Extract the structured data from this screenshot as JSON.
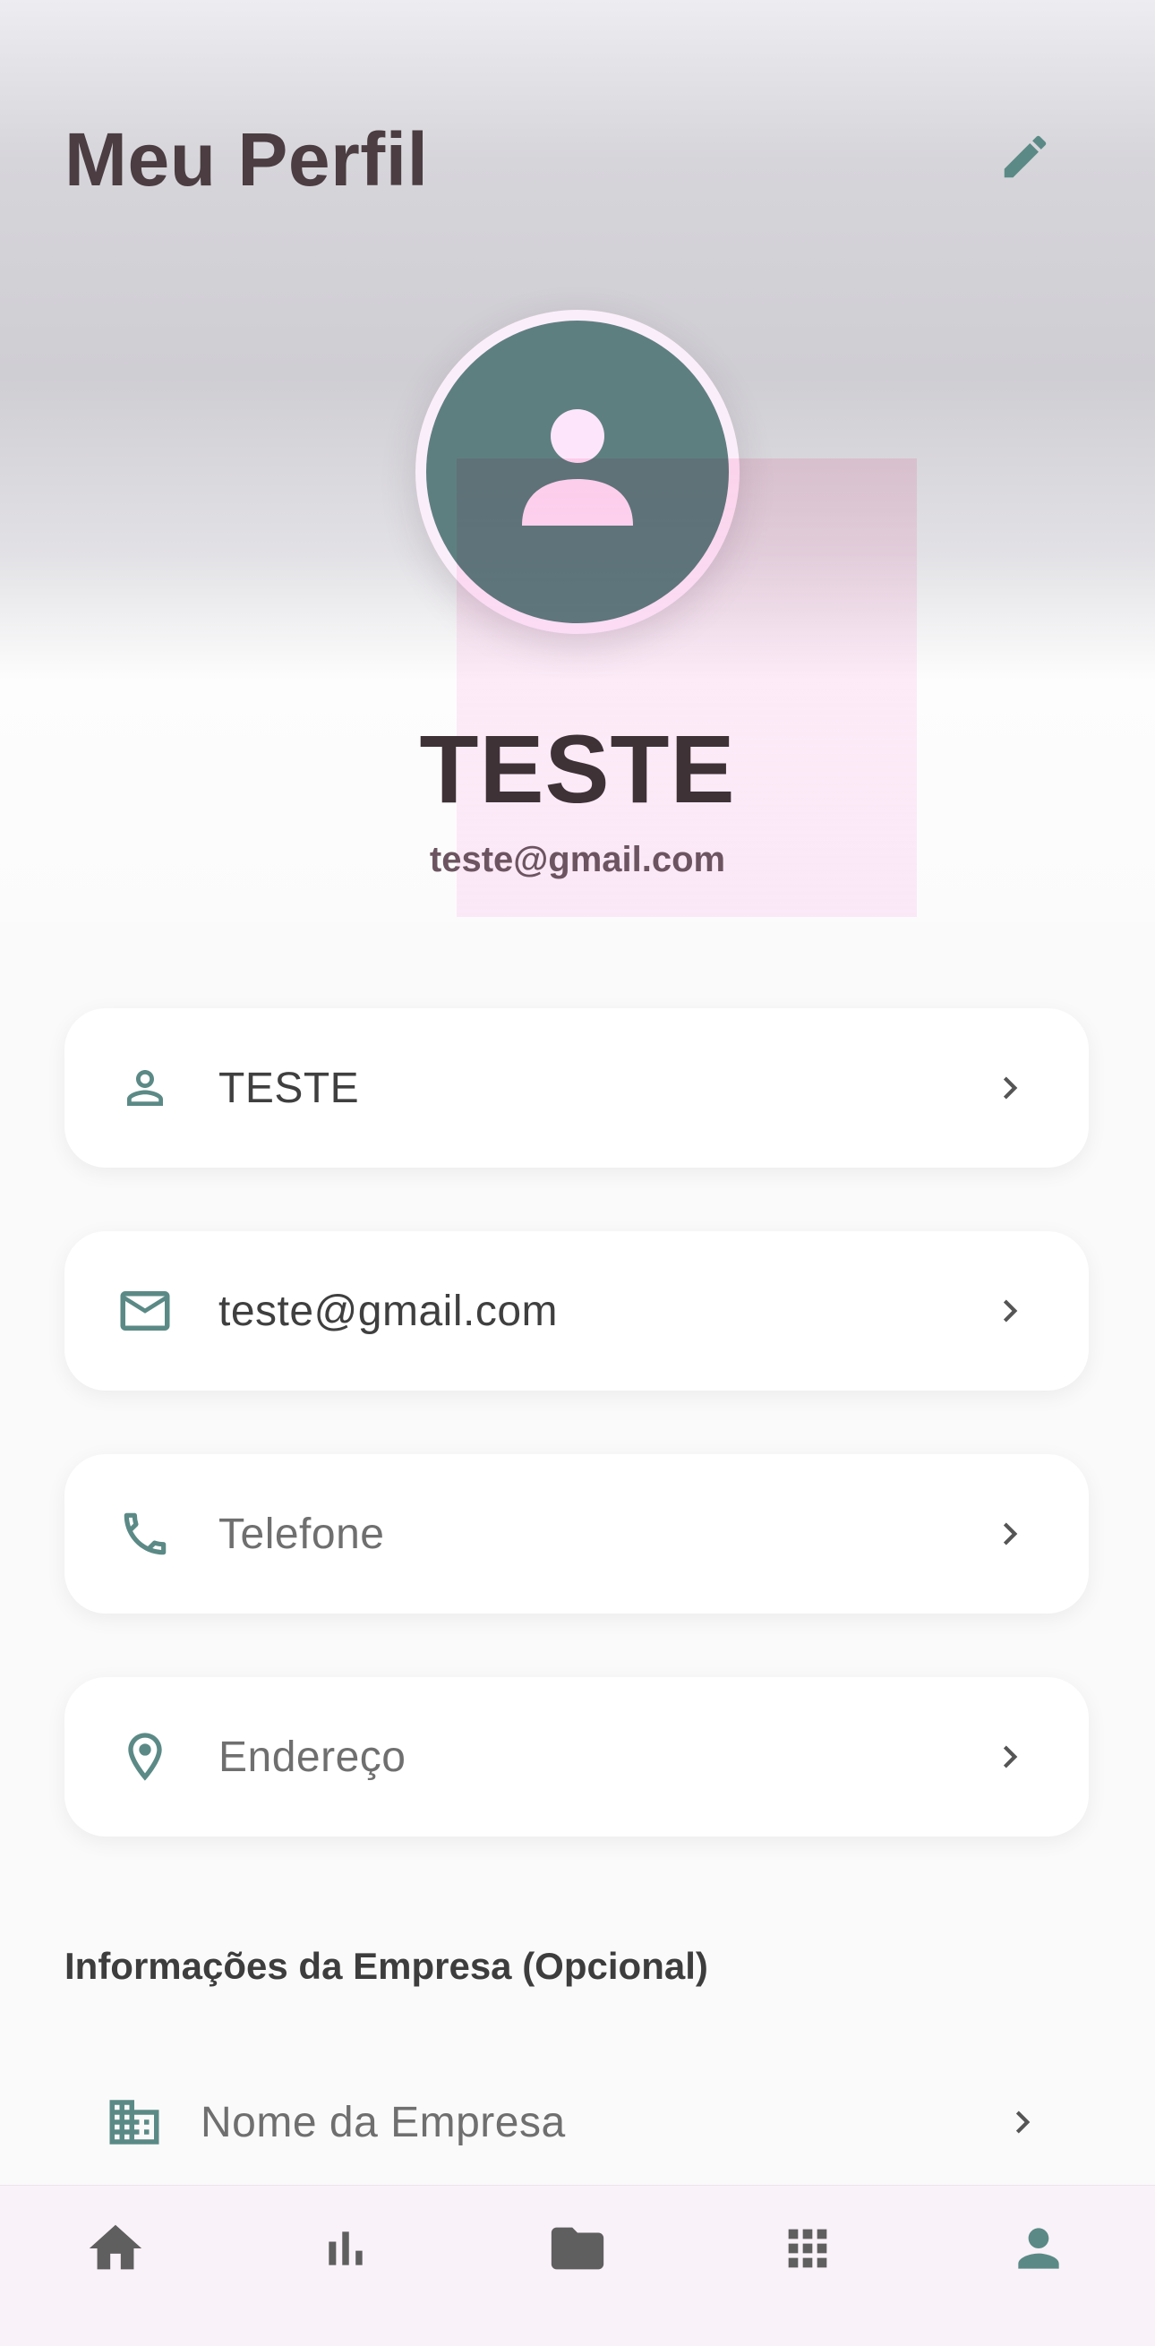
{
  "header": {
    "title": "Meu Perfil",
    "edit_icon": "pencil-edit-icon"
  },
  "profile": {
    "avatar_icon": "person-icon",
    "name": "TESTE",
    "email": "teste@gmail.com"
  },
  "fields": [
    {
      "icon": "person-outline-icon",
      "label": "TESTE",
      "filled": true
    },
    {
      "icon": "mail-icon",
      "label": "teste@gmail.com",
      "filled": true
    },
    {
      "icon": "phone-icon",
      "label": "Telefone",
      "filled": false
    },
    {
      "icon": "location-pin-icon",
      "label": "Endereço",
      "filled": false
    }
  ],
  "company_section": {
    "title": "Informações da Empresa (Opcional)",
    "items": [
      {
        "icon": "building-icon",
        "label": "Nome da Empresa"
      }
    ]
  },
  "bottom_nav": {
    "items": [
      {
        "icon": "home-icon",
        "active": false
      },
      {
        "icon": "bar-chart-icon",
        "active": false
      },
      {
        "icon": "folder-icon",
        "active": false
      },
      {
        "icon": "apps-grid-icon",
        "active": false
      },
      {
        "icon": "profile-icon",
        "active": true
      }
    ]
  },
  "colors": {
    "accent": "#5b8a86",
    "title_text": "#4b3d41",
    "avatar_bg": "#5e7f80",
    "nav_inactive": "#5f5f5f",
    "chevron": "#555555"
  }
}
